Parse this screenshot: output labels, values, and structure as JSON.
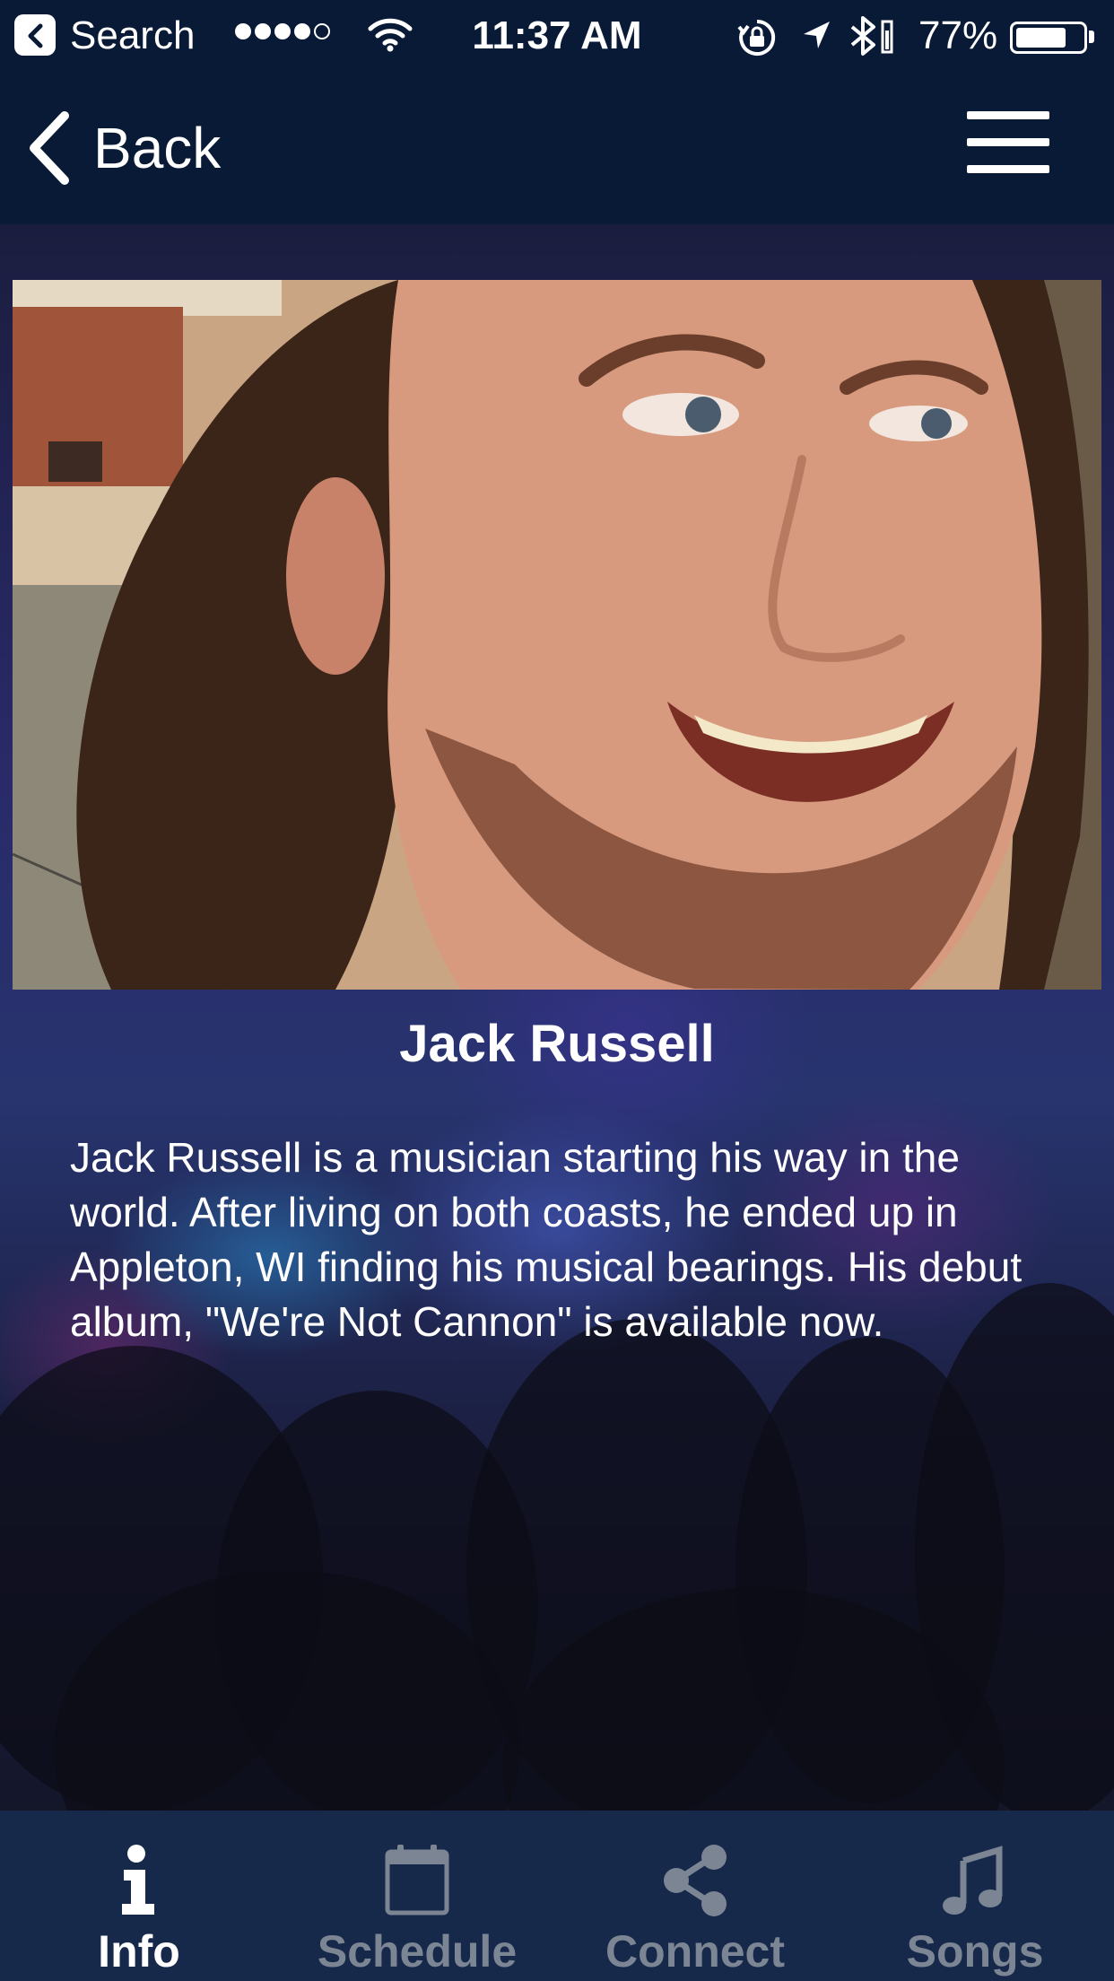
{
  "status_bar": {
    "source_app": "Search",
    "time": "11:37 AM",
    "battery_percent": "77%",
    "battery_level": 0.77,
    "signal_bars_filled": 4,
    "signal_bars_total": 5
  },
  "nav": {
    "back_label": "Back",
    "menu_icon": "hamburger-menu-icon"
  },
  "artist": {
    "name": "Jack Russell",
    "bio": "Jack Russell is a musician starting his way in the world. After living on both coasts, he ended up in Appleton, WI finding his musical bearings. His debut album, \"We're Not Cannon\" is available now."
  },
  "tabs": [
    {
      "label": "Info",
      "icon": "info-icon",
      "active": true
    },
    {
      "label": "Schedule",
      "icon": "calendar-icon",
      "active": false
    },
    {
      "label": "Connect",
      "icon": "share-icon",
      "active": false
    },
    {
      "label": "Songs",
      "icon": "music-note-icon",
      "active": false
    }
  ],
  "colors": {
    "bar_background": "#081a36",
    "tab_bar_background": "#16294a",
    "tab_active": "#ffffff",
    "tab_inactive": "#7c8593"
  }
}
